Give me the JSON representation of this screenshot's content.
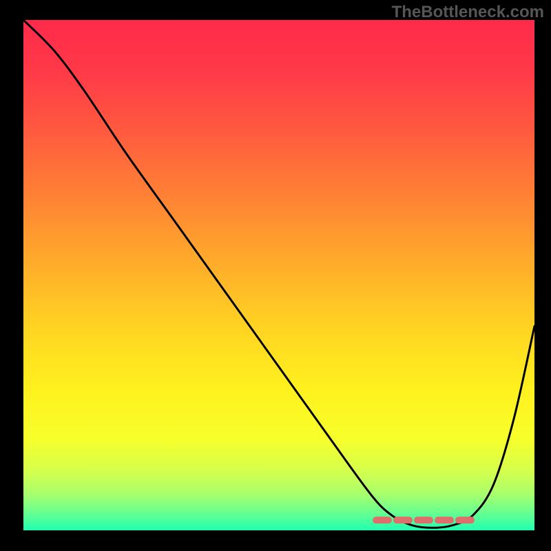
{
  "watermark": "TheBottleneck.com",
  "chart_data": {
    "type": "line",
    "title": "",
    "xlabel": "",
    "ylabel": "",
    "xlim": [
      0,
      100
    ],
    "ylim": [
      0,
      100
    ],
    "grid": false,
    "legend": false,
    "background_gradient": {
      "stops": [
        {
          "pos": 0.0,
          "color": "#ff2a4b"
        },
        {
          "pos": 0.1,
          "color": "#ff3948"
        },
        {
          "pos": 0.22,
          "color": "#ff5b3f"
        },
        {
          "pos": 0.35,
          "color": "#ff8334"
        },
        {
          "pos": 0.48,
          "color": "#ffad2a"
        },
        {
          "pos": 0.6,
          "color": "#ffd322"
        },
        {
          "pos": 0.72,
          "color": "#fff01e"
        },
        {
          "pos": 0.82,
          "color": "#f7ff2b"
        },
        {
          "pos": 0.88,
          "color": "#d8ff4a"
        },
        {
          "pos": 0.93,
          "color": "#a7ff6e"
        },
        {
          "pos": 0.97,
          "color": "#5fff94"
        },
        {
          "pos": 1.0,
          "color": "#1fffb0"
        }
      ]
    },
    "series": [
      {
        "name": "bottleneck-curve",
        "color": "#000000",
        "x": [
          0,
          6,
          12,
          20,
          30,
          40,
          50,
          60,
          68,
          72,
          76,
          80,
          84,
          88,
          92,
          96,
          100
        ],
        "y": [
          100,
          94,
          86,
          74,
          60,
          46,
          32,
          18,
          7,
          3,
          1,
          0.5,
          1,
          3,
          9,
          22,
          40
        ]
      }
    ],
    "optimal_zone": {
      "name": "bottleneck-free-range",
      "color": "#de6f6d",
      "x_start": 69,
      "x_end": 88,
      "y": 2
    }
  }
}
